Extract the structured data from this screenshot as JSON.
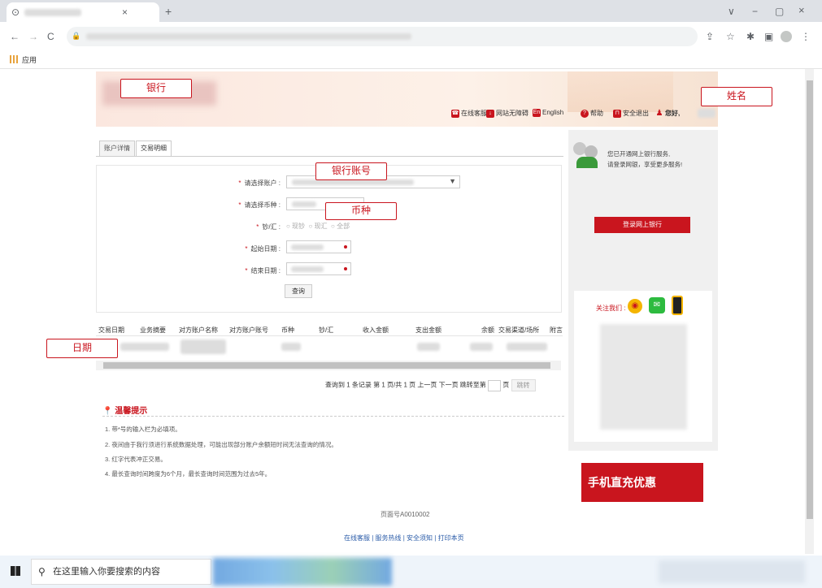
{
  "browser": {
    "tab_close": "×",
    "new_tab": "+",
    "window_controls": [
      "∨",
      "−",
      "▢",
      "×"
    ],
    "nav": [
      "←",
      "→",
      "C"
    ],
    "bookmarks_apps_label": "应用"
  },
  "header": {
    "links": [
      {
        "icon": "service-icon",
        "label": "在线客服"
      },
      {
        "icon": "accessibility-icon",
        "label": "网站无障碍"
      },
      {
        "icon": "english-icon",
        "label": "English",
        "badge": "En"
      },
      {
        "icon": "help-icon",
        "label": "帮助"
      },
      {
        "icon": "lock-icon",
        "label": "安全退出"
      },
      {
        "icon": "user-icon",
        "label": "您好,"
      }
    ]
  },
  "tabs": [
    {
      "label": "账户详情",
      "active": false
    },
    {
      "label": "交易明细",
      "active": true
    }
  ],
  "form": {
    "account_label": "请选择账户 :",
    "currency_label": "请选择币种 :",
    "cash_label": "钞/汇 :",
    "cash_options": [
      "现钞",
      "现汇",
      "全部"
    ],
    "start_label": "起始日期 :",
    "end_label": "结束日期 :",
    "query_button": "查询",
    "required_mark": "*"
  },
  "table": {
    "columns": [
      "交易日期",
      "业务摘要",
      "对方账户名称",
      "对方账户账号",
      "币种",
      "钞/汇",
      "收入金额",
      "支出金额",
      "余额",
      "交易渠道/场所",
      "附言"
    ]
  },
  "pager": {
    "text": "查询到 1 条记录  第 1 页/共 1 页  上一页  下一页  跳转至第",
    "page_suffix": "页",
    "jump_button": "跳转"
  },
  "tips": {
    "title": "温馨提示",
    "items": [
      "1. 带*号的输入栏为必填项。",
      "2. 夜间由于我行须进行系统数据处理，可能出现部分账户余额短时间无法查询的情况。",
      "3. 红字代表冲正交易。",
      "4. 最长查询时间跨度为6个月，最长查询时间范围为过去5年。"
    ]
  },
  "sidebar": {
    "message_line1": "您已开通网上银行服务,",
    "message_line2": "请登录网银，享受更多服务!",
    "login_button": "登录网上银行",
    "follow_label": "关注我们 :",
    "promo_text": "手机直充优惠"
  },
  "footer": {
    "page_id": "页面号A0010002",
    "links": "在线客服 | 服务热线 | 安全须知 | 打印本页"
  },
  "annotations": {
    "bank": "银行",
    "name": "姓名",
    "account": "银行账号",
    "currency": "币种",
    "date": "日期"
  },
  "taskbar": {
    "search_placeholder": "在这里输入你要搜索的内容"
  },
  "colors": {
    "brand_red": "#c9151e",
    "link_blue": "#2a5ba8"
  }
}
